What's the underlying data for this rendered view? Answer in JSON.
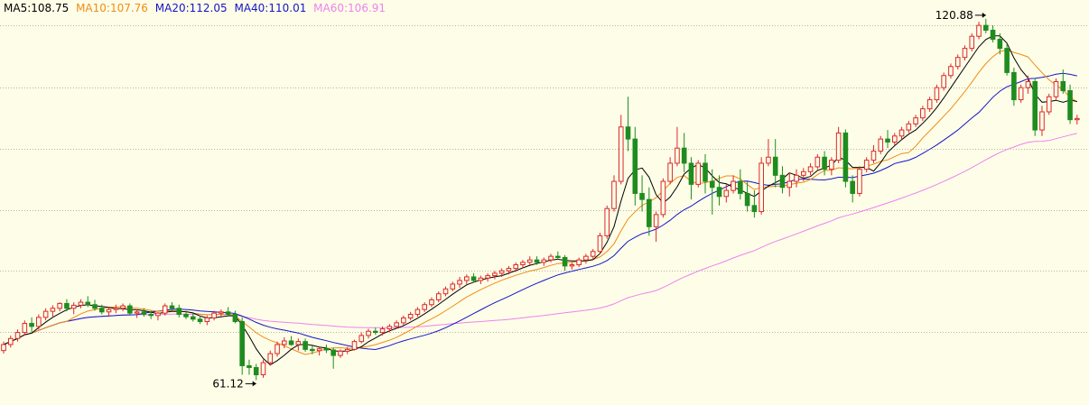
{
  "legend": [
    {
      "label": "MA5:108.75",
      "color": "#000000"
    },
    {
      "label": "MA10:107.76",
      "color": "#f08c14"
    },
    {
      "label": "MA20:112.05",
      "color": "#1414c8"
    },
    {
      "label": "MA40:110.01",
      "color": "#1414c8"
    },
    {
      "label": "MA60:106.91",
      "color": "#ee82ee"
    }
  ],
  "colors": {
    "background": "#fefee8",
    "up": "#dc2828",
    "down": "#1e8c1e",
    "grid": "#b4b4a0",
    "ma5": "#000000",
    "ma10": "#f08c14",
    "ma20": "#1414c8",
    "ma60": "#ee82ee"
  },
  "chart_data": {
    "type": "candlestick",
    "title": "",
    "ylim": [
      57,
      124
    ],
    "grid": "horizontal-dotted",
    "gridlines": [
      119.8,
      109.6,
      99.4,
      89.3,
      79.2,
      69.1
    ],
    "annotations": [
      {
        "label": "120.88",
        "value": 120.88,
        "kind": "high"
      },
      {
        "label": "61.12",
        "value": 61.12,
        "kind": "low"
      }
    ],
    "candles": [
      [
        66,
        67.5,
        65.5,
        67
      ],
      [
        67,
        68.5,
        66.5,
        68
      ],
      [
        68,
        69.5,
        67.5,
        69
      ],
      [
        69,
        71,
        68.5,
        70.5
      ],
      [
        70.5,
        71.5,
        69,
        70
      ],
      [
        70,
        72,
        69.5,
        71.5
      ],
      [
        71.5,
        73,
        71,
        72.5
      ],
      [
        72.5,
        73.5,
        71.5,
        73
      ],
      [
        73,
        74,
        72.5,
        73.8
      ],
      [
        73.8,
        74.5,
        72.5,
        73
      ],
      [
        73,
        74,
        72,
        73.5
      ],
      [
        73.5,
        74.5,
        73,
        74
      ],
      [
        74,
        75,
        73.2,
        73.6
      ],
      [
        73.6,
        74.4,
        72.6,
        73
      ],
      [
        73,
        73.6,
        72,
        72.4
      ],
      [
        72.4,
        73.2,
        71.6,
        72.8
      ],
      [
        72.8,
        73.6,
        72.2,
        73
      ],
      [
        73,
        73.8,
        72.5,
        73.4
      ],
      [
        73.4,
        73.8,
        71.8,
        72.2
      ],
      [
        72.2,
        72.8,
        71.4,
        72.4
      ],
      [
        72.4,
        73,
        71.6,
        72
      ],
      [
        72,
        72.6,
        71.2,
        71.8
      ],
      [
        71.8,
        72.4,
        71,
        72.2
      ],
      [
        72.2,
        73.8,
        71.8,
        73.4
      ],
      [
        73.4,
        74,
        72.5,
        73
      ],
      [
        73,
        73.6,
        71.5,
        72
      ],
      [
        72,
        72.6,
        71.2,
        71.6
      ],
      [
        71.6,
        72.2,
        70.8,
        71.2
      ],
      [
        71.2,
        71.8,
        70.4,
        70.8
      ],
      [
        70.8,
        71.8,
        70.2,
        71.4
      ],
      [
        71.4,
        72.6,
        71,
        72.2
      ],
      [
        72.2,
        72.8,
        71.6,
        72.4
      ],
      [
        72.4,
        73.2,
        71.8,
        72
      ],
      [
        72,
        72.6,
        70.5,
        70.8
      ],
      [
        70.8,
        71.5,
        62,
        63.5
      ],
      [
        63.5,
        64.5,
        62,
        63.2
      ],
      [
        63.2,
        63.8,
        61.12,
        62
      ],
      [
        62,
        64.5,
        61.5,
        64
      ],
      [
        64,
        66,
        63.5,
        65.5
      ],
      [
        65.5,
        67.5,
        65,
        67
      ],
      [
        67,
        68.2,
        66.4,
        67.6
      ],
      [
        67.6,
        68.4,
        66.8,
        67
      ],
      [
        67,
        68,
        66,
        67.5
      ],
      [
        67.5,
        68,
        65.8,
        66.2
      ],
      [
        66.2,
        66.8,
        65.4,
        66
      ],
      [
        66,
        66.6,
        65.2,
        66.3
      ],
      [
        66.3,
        67,
        65.6,
        66.1
      ],
      [
        66.1,
        66.5,
        63,
        65.2
      ],
      [
        65.2,
        66.2,
        64.8,
        65.9
      ],
      [
        65.9,
        66.6,
        65.4,
        66.2
      ],
      [
        66.2,
        67.8,
        66,
        67.5
      ],
      [
        67.5,
        69,
        67.2,
        68.5
      ],
      [
        68.5,
        69.6,
        68,
        69.2
      ],
      [
        69.2,
        69.8,
        68.6,
        69
      ],
      [
        69,
        70,
        68.5,
        69.6
      ],
      [
        69.6,
        70.4,
        69,
        70
      ],
      [
        70,
        71,
        69.6,
        70.6
      ],
      [
        70.6,
        71.8,
        70.2,
        71.4
      ],
      [
        71.4,
        72.4,
        71,
        72
      ],
      [
        72,
        73.2,
        71.6,
        72.8
      ],
      [
        72.8,
        74,
        72.4,
        73.6
      ],
      [
        73.6,
        74.8,
        73.2,
        74.4
      ],
      [
        74.4,
        75.8,
        74,
        75.4
      ],
      [
        75.4,
        76.6,
        75,
        76.2
      ],
      [
        76.2,
        77.4,
        75.8,
        77
      ],
      [
        77,
        78.2,
        76.4,
        77.6
      ],
      [
        77.6,
        78.6,
        77,
        78.2
      ],
      [
        78.2,
        78.8,
        77.2,
        77.6
      ],
      [
        77.6,
        78.4,
        77,
        78
      ],
      [
        78,
        78.8,
        77.4,
        78.4
      ],
      [
        78.4,
        79.2,
        77.8,
        78.8
      ],
      [
        78.8,
        79.6,
        78.2,
        79.2
      ],
      [
        79.2,
        80,
        78.6,
        79.6
      ],
      [
        79.6,
        80.6,
        79,
        80.2
      ],
      [
        80.2,
        81,
        79.6,
        80.6
      ],
      [
        80.6,
        81.6,
        80.2,
        81
      ],
      [
        81,
        81.6,
        80.2,
        80.6
      ],
      [
        80.6,
        81.4,
        80,
        81
      ],
      [
        81,
        82,
        80.6,
        81.6
      ],
      [
        81.6,
        82.4,
        81,
        81.4
      ],
      [
        81.4,
        81.8,
        79.2,
        80
      ],
      [
        80,
        80.6,
        79.4,
        80.2
      ],
      [
        80.2,
        81.4,
        79.8,
        81
      ],
      [
        81,
        82,
        80.4,
        81.6
      ],
      [
        81.6,
        82.8,
        81.2,
        82.4
      ],
      [
        82.4,
        85.5,
        82,
        85
      ],
      [
        85,
        90,
        84.5,
        89.5
      ],
      [
        89.5,
        95,
        89,
        94
      ],
      [
        94,
        105,
        93.5,
        103
      ],
      [
        103,
        108,
        99,
        101
      ],
      [
        101,
        103,
        90,
        92
      ],
      [
        92,
        95,
        89,
        91
      ],
      [
        91,
        93,
        85,
        86.5
      ],
      [
        86.5,
        89,
        84,
        88.5
      ],
      [
        88.5,
        94.5,
        88,
        94
      ],
      [
        94,
        98,
        93.5,
        97
      ],
      [
        97,
        103,
        96.5,
        99.5
      ],
      [
        99.5,
        102,
        95.5,
        97
      ],
      [
        97,
        98,
        91,
        93.5
      ],
      [
        93.5,
        97.5,
        93,
        97
      ],
      [
        97,
        98.5,
        92,
        94
      ],
      [
        94,
        96,
        88.5,
        93
      ],
      [
        93,
        95,
        90,
        91.5
      ],
      [
        91.5,
        93.5,
        90.5,
        92.5
      ],
      [
        92.5,
        95,
        92,
        94
      ],
      [
        94,
        96,
        91,
        92
      ],
      [
        92,
        94,
        89,
        90
      ],
      [
        90,
        92.5,
        88,
        89
      ],
      [
        89,
        98,
        88.5,
        97
      ],
      [
        97,
        101,
        96.5,
        98
      ],
      [
        98,
        101,
        93,
        95
      ],
      [
        95,
        96.5,
        92,
        93
      ],
      [
        93,
        95.5,
        91.5,
        94
      ],
      [
        94,
        96,
        93,
        95
      ],
      [
        95,
        96.2,
        94,
        95.6
      ],
      [
        95.6,
        97,
        95,
        96.4
      ],
      [
        96.4,
        98.5,
        96,
        98
      ],
      [
        98,
        99,
        95,
        96
      ],
      [
        96,
        98,
        95,
        97.5
      ],
      [
        97.5,
        103,
        97,
        102
      ],
      [
        102,
        102.6,
        93,
        94
      ],
      [
        94,
        95,
        90.5,
        92
      ],
      [
        92,
        96.5,
        91.5,
        96
      ],
      [
        96,
        98,
        95.5,
        97.5
      ],
      [
        97.5,
        100,
        97,
        99
      ],
      [
        99,
        101.5,
        98.5,
        101
      ],
      [
        101,
        102.5,
        99.5,
        100.5
      ],
      [
        100.5,
        102,
        100,
        101.5
      ],
      [
        101.5,
        103,
        101,
        102.5
      ],
      [
        102.5,
        104,
        102,
        103.5
      ],
      [
        103.5,
        105,
        103,
        104.5
      ],
      [
        104.5,
        106.5,
        104,
        106
      ],
      [
        106,
        108,
        105.5,
        107.5
      ],
      [
        107.5,
        110,
        107,
        109.5
      ],
      [
        109.5,
        112,
        109,
        111.5
      ],
      [
        111.5,
        113.5,
        111,
        113
      ],
      [
        113,
        115,
        112.5,
        114.5
      ],
      [
        114.5,
        116.5,
        114,
        116
      ],
      [
        116,
        118.5,
        115.5,
        118
      ],
      [
        118,
        120.4,
        117.5,
        119.8
      ],
      [
        119.8,
        120.88,
        118.5,
        119
      ],
      [
        119,
        119.8,
        117,
        117.5
      ],
      [
        117.5,
        118.5,
        115,
        116
      ],
      [
        116,
        116.8,
        111.5,
        112
      ],
      [
        112,
        112.8,
        106.5,
        107.5
      ],
      [
        107.5,
        110,
        107,
        109.5
      ],
      [
        109.5,
        111.5,
        108.5,
        110.5
      ],
      [
        110.5,
        111,
        101.5,
        102.5
      ],
      [
        102.5,
        106.5,
        101.5,
        105.5
      ],
      [
        105.5,
        108.5,
        105,
        108
      ],
      [
        108,
        111,
        107.5,
        110.5
      ],
      [
        110.5,
        112.5,
        108.5,
        109
      ],
      [
        109,
        110,
        103.5,
        104.2
      ],
      [
        104.2,
        105,
        103.4,
        104.4
      ]
    ]
  }
}
